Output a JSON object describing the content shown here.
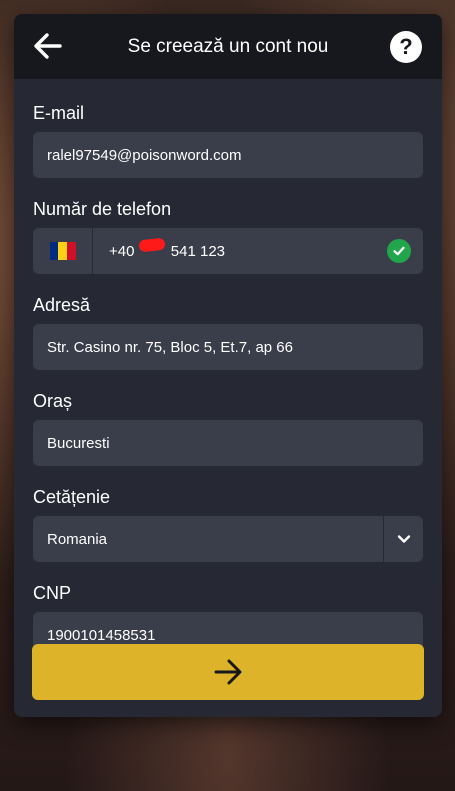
{
  "header": {
    "title": "Se creează un cont nou",
    "back_icon": "arrow-left-icon",
    "help_label": "?"
  },
  "fields": {
    "email": {
      "label": "E-mail",
      "value": "ralel97549@poisonword.com"
    },
    "phone": {
      "label": "Număr de telefon",
      "prefix": "+40",
      "value": "541 123",
      "flag": "romania-flag-icon",
      "status_icon": "check-circle-icon"
    },
    "address": {
      "label": "Adresă",
      "value": "Str. Casino nr. 75, Bloc 5, Et.7, ap 66"
    },
    "city": {
      "label": "Oraș",
      "value": "Bucuresti"
    },
    "citizenship": {
      "label": "Cetățenie",
      "value": "Romania",
      "dropdown_icon": "chevron-down-icon"
    },
    "cnp": {
      "label": "CNP",
      "value": "1900101458531"
    }
  },
  "submit": {
    "icon": "arrow-right-icon"
  },
  "colors": {
    "accent": "#ddb32a",
    "success": "#22a64b",
    "panel": "#262934",
    "field": "#3a3d4a",
    "header": "#17181d"
  }
}
